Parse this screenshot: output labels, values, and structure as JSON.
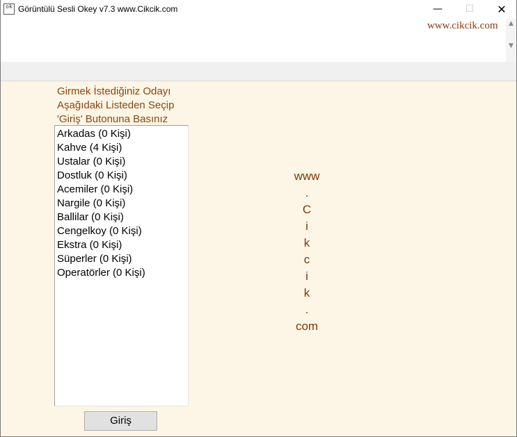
{
  "window": {
    "title": "Görüntülü Sesli Okey v7.3 www.Cikcik.com",
    "icon_text": "ok",
    "controls": {
      "minimize": "—",
      "maximize": "☐",
      "close": "✕"
    }
  },
  "banner": {
    "link_text": "www.cikcik.com",
    "scroll_up": "▲",
    "scroll_down": "▼"
  },
  "instructions": {
    "line1": "Girmek İstediğiniz Odayı",
    "line2": "Aşağıdaki Listeden Seçip",
    "line3": "'Giriş' Butonuna Basınız"
  },
  "rooms": [
    "Arkadas (0 Kişi)",
    "Kahve (4 Kişi)",
    "Ustalar (0 Kişi)",
    "Dostluk (0 Kişi)",
    "Acemiler (0 Kişi)",
    "Nargile (0 Kişi)",
    "Ballilar (0 Kişi)",
    "Cengelkoy (0 Kişi)",
    "Ekstra (0 Kişi)",
    "Süperler (0 Kişi)",
    "Operatörler (0 Kişi)"
  ],
  "enter_button": "Giriş",
  "side_text": [
    "www",
    ".",
    "C",
    "i",
    "k",
    "c",
    "i",
    "k",
    ".",
    "com"
  ],
  "colors": {
    "background": "#fdf6e6",
    "instruction_text": "#8b4513",
    "brand_link": "#8b3a0e"
  }
}
